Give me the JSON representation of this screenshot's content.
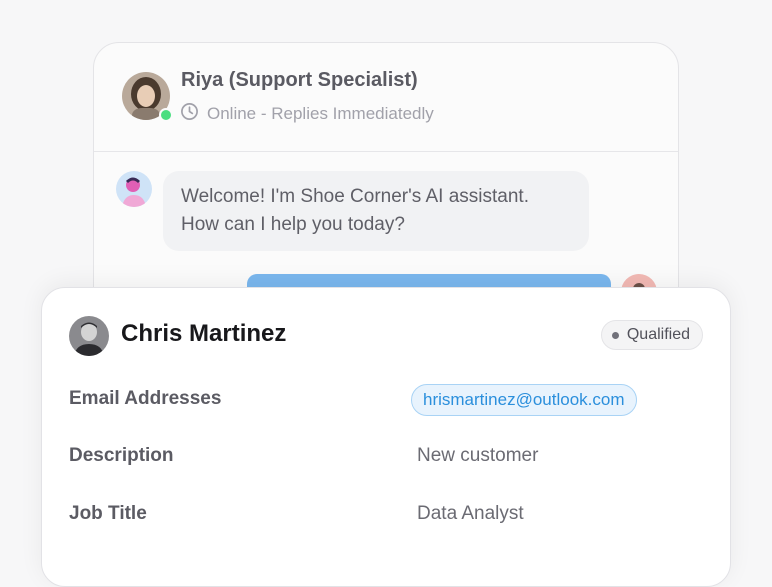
{
  "chat": {
    "agent_name": "Riya (Support Specialist)",
    "status_text": "Online - Replies Immediatedly",
    "messages": {
      "bot_line1": "Welcome! I'm Shoe Corner's AI assistant.",
      "bot_line2": "How can I help you today?"
    },
    "colors": {
      "online": "#4ade80",
      "user_bubble": "#7ab7ee"
    },
    "icons": {
      "status": "clock-icon"
    }
  },
  "contact": {
    "name": "Chris Martinez",
    "status_badge": "Qualified",
    "fields": [
      {
        "label": "Email Addresses",
        "value": "hrismartinez@outlook.com"
      },
      {
        "label": "Description",
        "value": "New customer"
      },
      {
        "label": "Job Title",
        "value": "Data Analyst"
      }
    ],
    "colors": {
      "email_pill_text": "#2b8fdc",
      "email_pill_bg": "#e8f3fd"
    }
  }
}
